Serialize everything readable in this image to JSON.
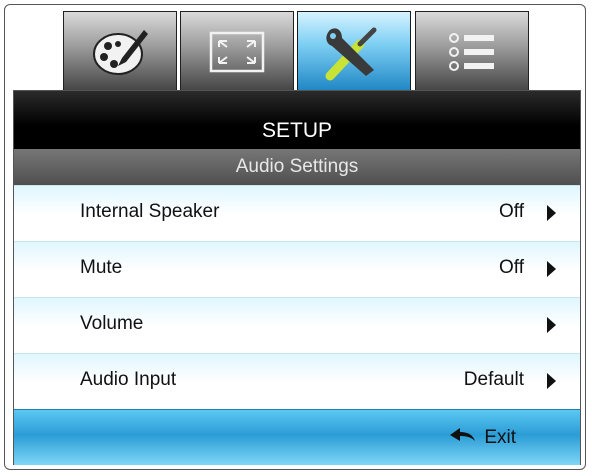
{
  "tabs": [
    {
      "id": "image",
      "icon": "palette-brush-icon"
    },
    {
      "id": "display",
      "icon": "fullscreen-arrows-icon"
    },
    {
      "id": "setup",
      "icon": "wrench-screwdriver-icon",
      "active": true
    },
    {
      "id": "options",
      "icon": "list-options-icon"
    }
  ],
  "menu": {
    "title": "SETUP",
    "subtitle": "Audio Settings"
  },
  "items": [
    {
      "label": "Internal Speaker",
      "value": "Off"
    },
    {
      "label": "Mute",
      "value": "Off"
    },
    {
      "label": "Volume",
      "value": ""
    },
    {
      "label": "Audio Input",
      "value": "Default"
    }
  ],
  "footer": {
    "exit_label": "Exit"
  },
  "colors": {
    "active_tab": "#7fd0f4",
    "header": "#000000",
    "subheader": "#5a5a5a",
    "exit_bar": "#2b9cd6"
  }
}
